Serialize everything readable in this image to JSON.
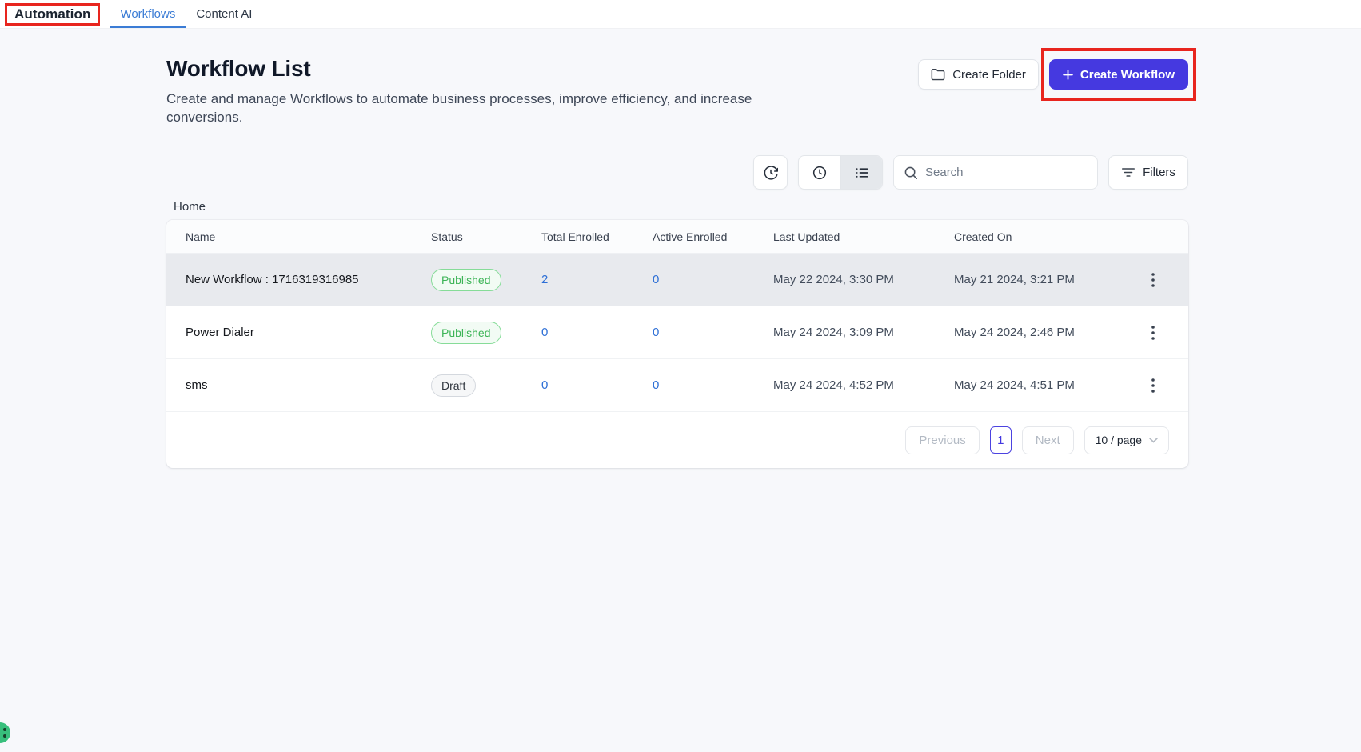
{
  "topnav": {
    "brand": "Automation",
    "tabs": [
      {
        "label": "Workflows",
        "active": true
      },
      {
        "label": "Content AI",
        "active": false
      }
    ]
  },
  "header": {
    "title": "Workflow List",
    "subtitle": "Create and manage Workflows to automate business processes, improve efficiency, and increase conversions.",
    "create_folder": "Create Folder",
    "create_workflow": "Create Workflow"
  },
  "toolbar": {
    "icon_buttons": [
      "history-icon",
      "clock-icon",
      "list-view-icon"
    ],
    "search_placeholder": "Search",
    "filters": "Filters"
  },
  "breadcrumb": "Home",
  "table": {
    "columns": [
      "Name",
      "Status",
      "Total Enrolled",
      "Active Enrolled",
      "Last Updated",
      "Created On"
    ],
    "rows": [
      {
        "name": "New Workflow : 1716319316985",
        "status": "Published",
        "status_type": "published",
        "total_enrolled": "2",
        "active_enrolled": "0",
        "last_updated": "May 22 2024, 3:30 PM",
        "created_on": "May 21 2024, 3:21 PM",
        "highlighted": true
      },
      {
        "name": "Power Dialer",
        "status": "Published",
        "status_type": "published",
        "total_enrolled": "0",
        "active_enrolled": "0",
        "last_updated": "May 24 2024, 3:09 PM",
        "created_on": "May 24 2024, 2:46 PM",
        "highlighted": false
      },
      {
        "name": "sms",
        "status": "Draft",
        "status_type": "draft",
        "total_enrolled": "0",
        "active_enrolled": "0",
        "last_updated": "May 24 2024, 4:52 PM",
        "created_on": "May 24 2024, 4:51 PM",
        "highlighted": false
      }
    ]
  },
  "pagination": {
    "previous": "Previous",
    "current_page": "1",
    "next": "Next",
    "page_size": "10 / page"
  },
  "colors": {
    "primary_button": "#4539e0",
    "active_tab_blue": "#3b7cd5",
    "annotation_red": "#e8251e",
    "published_green": "#3db457",
    "count_link_blue": "#2d6fd6",
    "highlighted_row": "#e8eaee"
  }
}
